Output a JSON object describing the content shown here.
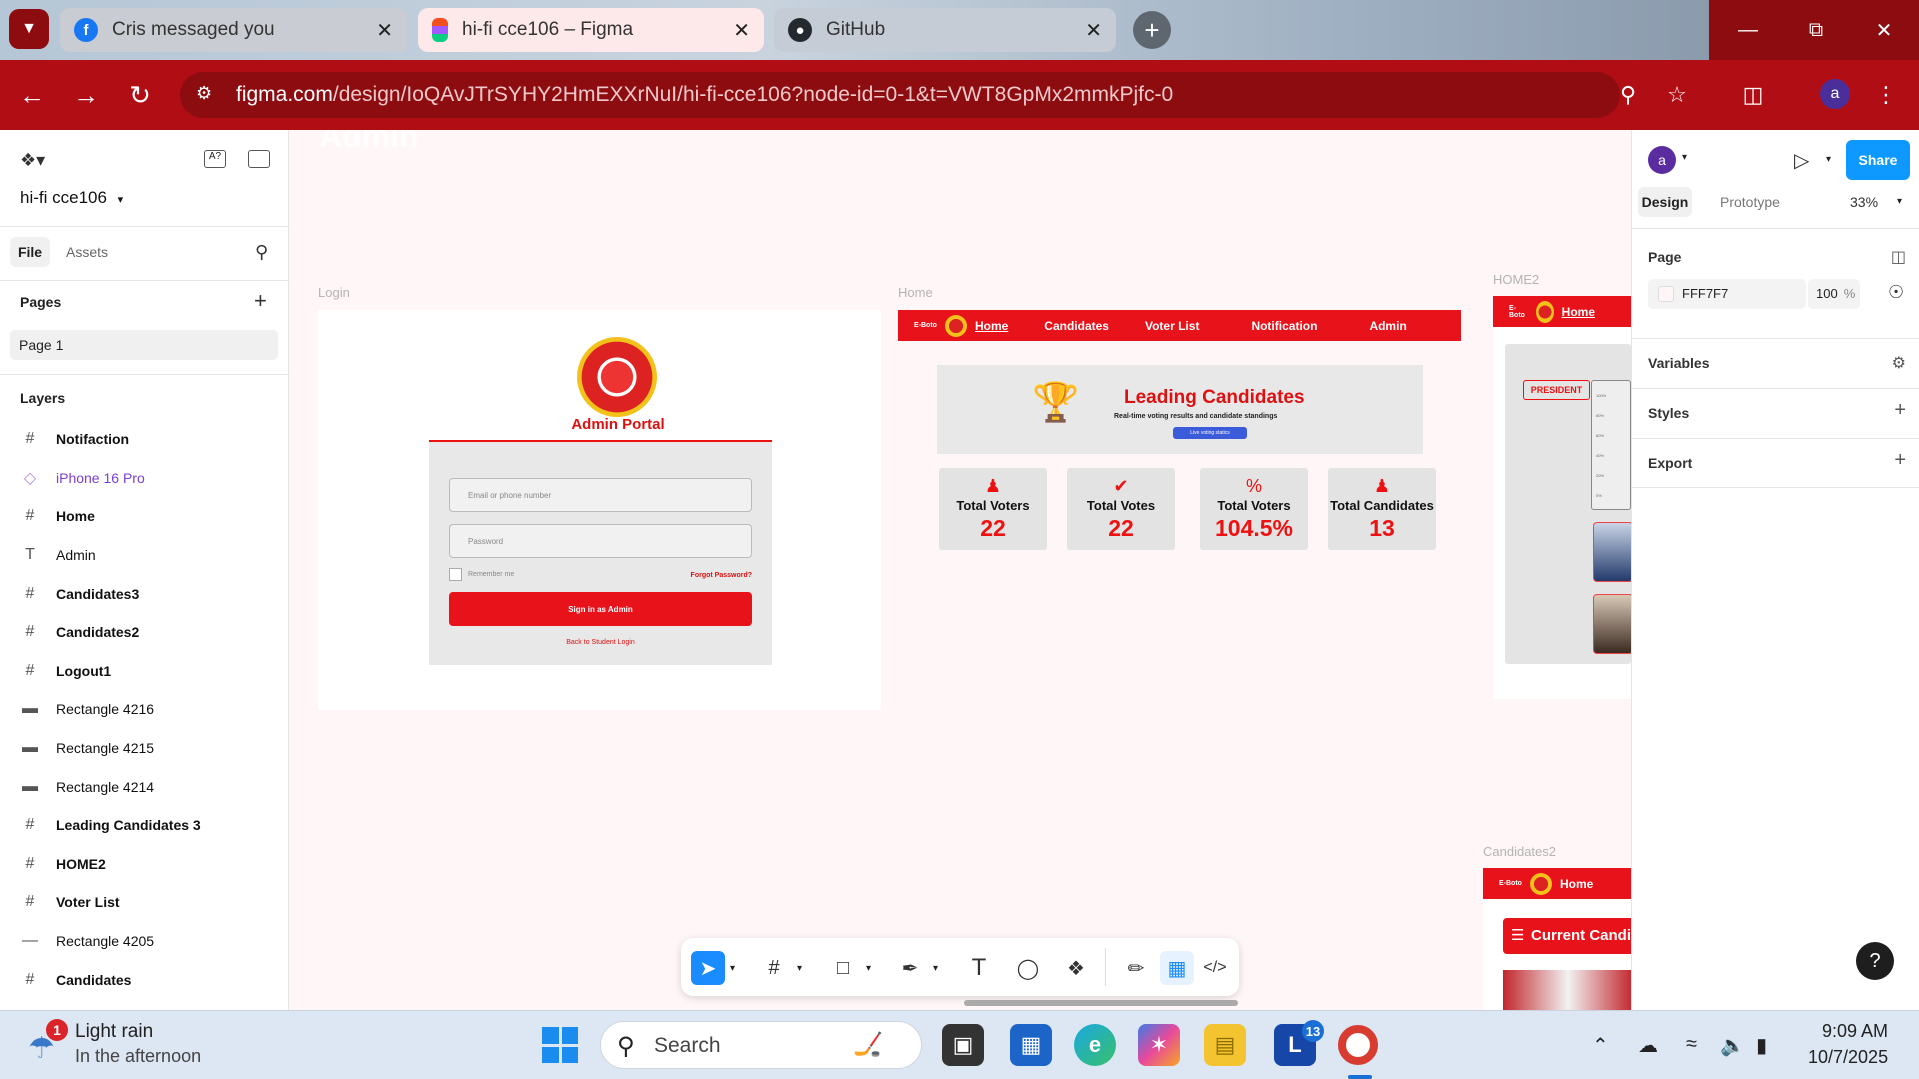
{
  "browser": {
    "tabs": [
      {
        "label": "Cris messaged you",
        "icon": "facebook-icon"
      },
      {
        "label": "hi-fi cce106 – Figma",
        "icon": "figma-icon"
      },
      {
        "label": "GitHub",
        "icon": "github-icon"
      }
    ],
    "url_main": "figma.com",
    "url_rest": "/design/IoQAvJTrSYHY2HmEXXrNuI/hi-fi-cce106?node-id=0-1&t=VWT8GpMx2mmkPjfc-0",
    "profile_initial": "a",
    "accent": "#b00e14"
  },
  "left_panel": {
    "file_name": "hi-fi cce106",
    "tabs": {
      "file": "File",
      "assets": "Assets"
    },
    "pages_title": "Pages",
    "pages": [
      "Page 1"
    ],
    "layers_title": "Layers",
    "layers": [
      {
        "name": "Notifaction",
        "icon": "frame-icon"
      },
      {
        "name": "iPhone 16 Pro",
        "icon": "component-icon"
      },
      {
        "name": "Home",
        "icon": "frame-icon"
      },
      {
        "name": "Admin",
        "icon": "text-icon"
      },
      {
        "name": "Candidates3",
        "icon": "frame-icon"
      },
      {
        "name": "Candidates2",
        "icon": "frame-icon"
      },
      {
        "name": "Logout1",
        "icon": "frame-icon"
      },
      {
        "name": "Rectangle 4216",
        "icon": "rectangle-icon"
      },
      {
        "name": "Rectangle 4215",
        "icon": "rectangle-icon"
      },
      {
        "name": "Rectangle 4214",
        "icon": "rectangle-icon"
      },
      {
        "name": " Leading Candidates 3",
        "icon": "frame-icon"
      },
      {
        "name": "HOME2",
        "icon": "frame-icon"
      },
      {
        "name": "Voter List",
        "icon": "frame-icon"
      },
      {
        "name": "Rectangle 4205",
        "icon": "line-icon"
      },
      {
        "name": "Candidates",
        "icon": "frame-icon"
      }
    ]
  },
  "canvas": {
    "bg_color": "#fff7f7",
    "partial_heading": "Admin",
    "frames": {
      "login": "Login",
      "home": "Home",
      "home2": "HOME2",
      "candidates2": "Candidates2"
    },
    "login": {
      "portal_title": "Admin Portal",
      "email_placeholder": "Email or phone number",
      "password_placeholder": "Password",
      "remember": "Remember me",
      "forgot": "Forgot Password?",
      "signin": "Sign in as Admin",
      "back": "Back to Student Login"
    },
    "home": {
      "brand": "E-Boto",
      "nav": [
        "Home",
        "Candidates",
        "Voter List",
        "Notification",
        "Admin"
      ],
      "leading_title": "Leading Candidates",
      "leading_sub": "Real-time voting results and candidate standings",
      "live_btn": "Live voting statics",
      "stats": [
        {
          "label": "Total Voters",
          "value": "22",
          "icon": "users-icon"
        },
        {
          "label": "Total Votes",
          "value": "22",
          "icon": "check-circle-icon"
        },
        {
          "label": "Total Voters",
          "value": "104.5%",
          "icon": "percent-icon"
        },
        {
          "label": "Total Candidates",
          "value": "13",
          "icon": "users-icon"
        }
      ]
    },
    "home2": {
      "brand": "E-Boto",
      "nav_home": "Home",
      "president": "PRESIDENT",
      "axis_ticks": [
        "100%",
        "80%",
        "60%",
        "40%",
        "20%",
        "0%"
      ]
    },
    "candidates2": {
      "brand": "E-Boto",
      "nav_home": "Home",
      "current": "Current Candid"
    }
  },
  "right_panel": {
    "avatar": "a",
    "share": "Share",
    "design_tab": "Design",
    "prototype_tab": "Prototype",
    "zoom": "33%",
    "page_title": "Page",
    "page_color": "FFF7F7",
    "page_opacity": "100",
    "opacity_unit": "%",
    "variables": "Variables",
    "styles": "Styles",
    "export": "Export",
    "help": "?"
  },
  "taskbar": {
    "weather_title": "Light rain",
    "weather_sub": "In the afternoon",
    "weather_badge": "1",
    "search_placeholder": "Search",
    "time": "9:09 AM",
    "date": "10/7/2025",
    "app_badge": "13"
  }
}
